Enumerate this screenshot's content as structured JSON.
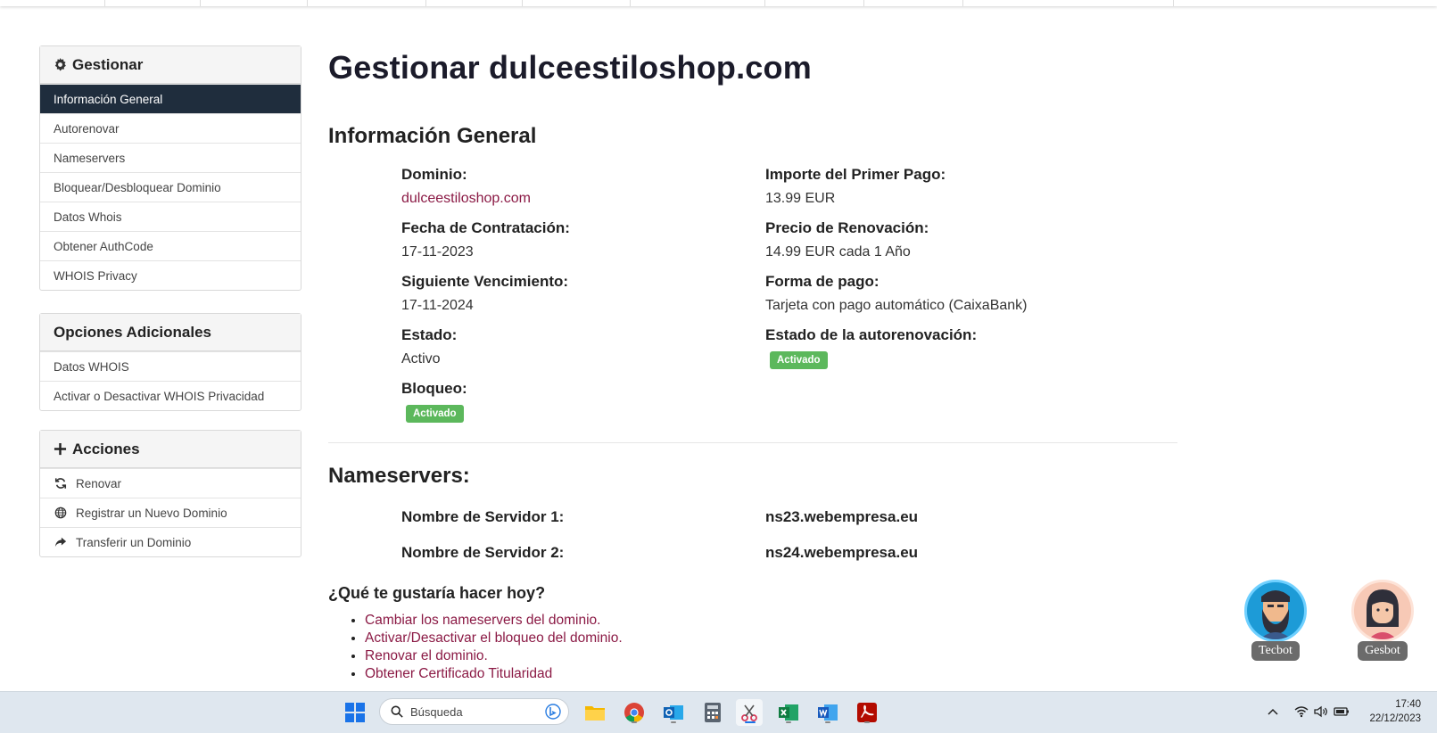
{
  "sidebar": {
    "manage": {
      "title": "Gestionar",
      "items": [
        "Información General",
        "Autorenovar",
        "Nameservers",
        "Bloquear/Desbloquear Dominio",
        "Datos Whois",
        "Obtener AuthCode",
        "WHOIS Privacy"
      ]
    },
    "extra": {
      "title": "Opciones Adicionales",
      "items": [
        "Datos WHOIS",
        "Activar o Desactivar WHOIS Privacidad"
      ]
    },
    "actions": {
      "title": "Acciones",
      "items": [
        "Renovar",
        "Registrar un Nuevo Dominio",
        "Transferir un Dominio"
      ]
    }
  },
  "main": {
    "title": "Gestionar dulceestiloshop.com",
    "section_info": "Información General",
    "domain_label": "Dominio:",
    "domain_value": "dulceestiloshop.com",
    "contract_label": "Fecha de Contratación:",
    "contract_value": "17-11-2023",
    "expiry_label": "Siguiente Vencimiento:",
    "expiry_value": "17-11-2024",
    "status_label": "Estado:",
    "status_value": "Activo",
    "lock_label": "Bloqueo:",
    "lock_badge": "Activado",
    "first_payment_label": "Importe del Primer Pago:",
    "first_payment_value": "13.99 EUR",
    "renewal_label": "Precio de Renovación:",
    "renewal_value": "14.99 EUR cada 1 Año",
    "payment_label": "Forma de pago:",
    "payment_value": "Tarjeta con pago automático (CaixaBank)",
    "autorenew_label": "Estado de la autorenovación:",
    "autorenew_badge": "Activado",
    "section_ns": "Nameservers:",
    "ns1_label": "Nombre de Servidor 1:",
    "ns1_value": "ns23.webempresa.eu",
    "ns2_label": "Nombre de Servidor 2:",
    "ns2_value": "ns24.webempresa.eu",
    "question": "¿Qué te gustaría hacer hoy?",
    "todo": [
      "Cambiar los nameservers del dominio.",
      "Activar/Desactivar el bloqueo del dominio.",
      "Renovar el dominio.",
      "Obtener Certificado Titularidad"
    ]
  },
  "bots": {
    "tecbot": "Tecbot",
    "gesbot": "Gesbot"
  },
  "taskbar": {
    "search_placeholder": "Búsqueda",
    "time": "17:40",
    "date": "22/12/2023"
  },
  "colors": {
    "active_nav": "#1f2d3d",
    "link": "#8b1a45",
    "badge": "#5cb85c"
  }
}
